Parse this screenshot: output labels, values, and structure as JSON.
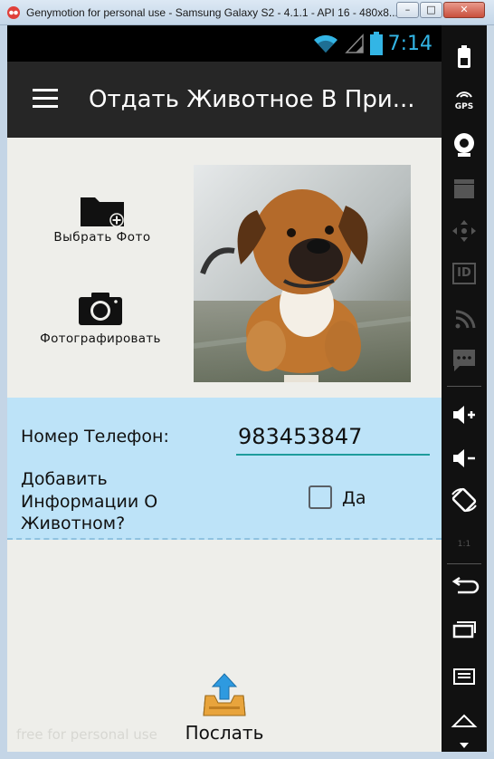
{
  "window": {
    "title": "Genymotion for personal use - Samsung Galaxy S2 - 4.1.1 - API 16 - 480x8...",
    "minimize_glyph": "–",
    "maximize_glyph": "□",
    "close_glyph": "✕"
  },
  "status_bar": {
    "time": "7:14",
    "icons": [
      "wifi-icon",
      "signal-icon",
      "battery-icon"
    ],
    "accent_color": "#33b5e5"
  },
  "action_bar": {
    "title": "Отдать Животное В При..."
  },
  "photo_actions": {
    "choose_label": "Выбрать Фото",
    "take_label": "Фотографировать"
  },
  "form": {
    "phone_label": "Номер Телефон:",
    "phone_value": "983453847",
    "info_label": "Добавить Информации О Животном?",
    "checkbox_label": "Да",
    "checkbox_checked": false
  },
  "send": {
    "label": "Послать"
  },
  "watermark": "free for personal use",
  "side_toolbar": {
    "items": [
      "battery-icon",
      "gps-icon",
      "webcam-icon",
      "clapper-icon",
      "dpad-icon",
      "id-icon",
      "cast-icon",
      "sms-icon",
      "volume-up-icon",
      "volume-down-icon",
      "rotate-icon",
      "scale-icon",
      "back-icon",
      "recent-apps-icon",
      "menu-icon",
      "home-icon"
    ],
    "gps_text": "GPS",
    "id_text": "ID",
    "scale_text": "1:1"
  }
}
